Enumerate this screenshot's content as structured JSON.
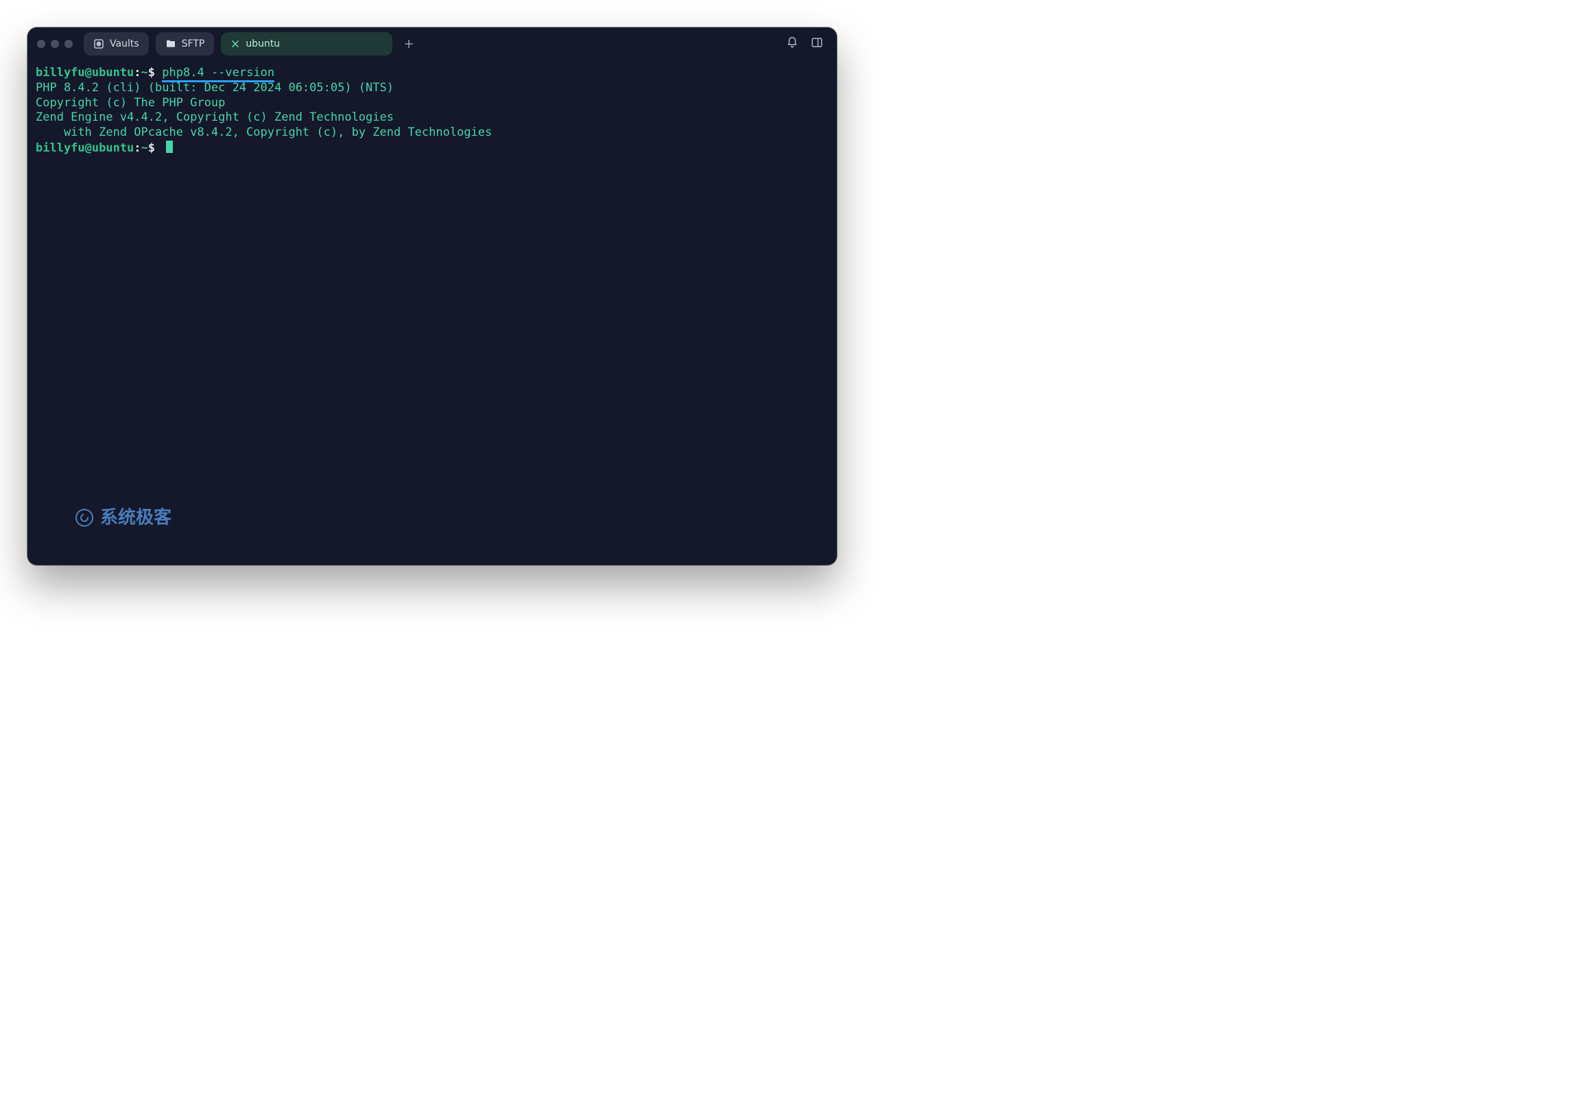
{
  "titlebar": {
    "tabs": [
      {
        "id": "vaults",
        "label": "Vaults",
        "icon": "vault-icon"
      },
      {
        "id": "sftp",
        "label": "SFTP",
        "icon": "folder-icon"
      },
      {
        "id": "ubuntu",
        "label": "ubuntu",
        "icon": "close-icon",
        "active": true
      }
    ],
    "add_tab_label": "+"
  },
  "terminal": {
    "prompt": {
      "user": "billyfu",
      "host": "ubuntu",
      "path": "~",
      "symbol": "$"
    },
    "command": "php8.4 --version",
    "output": [
      "PHP 8.4.2 (cli) (built: Dec 24 2024 06:05:05) (NTS)",
      "Copyright (c) The PHP Group",
      "Zend Engine v4.4.2, Copyright (c) Zend Technologies",
      "    with Zend OPcache v8.4.2, Copyright (c), by Zend Technologies"
    ]
  },
  "watermark": {
    "text": "系统极客"
  }
}
